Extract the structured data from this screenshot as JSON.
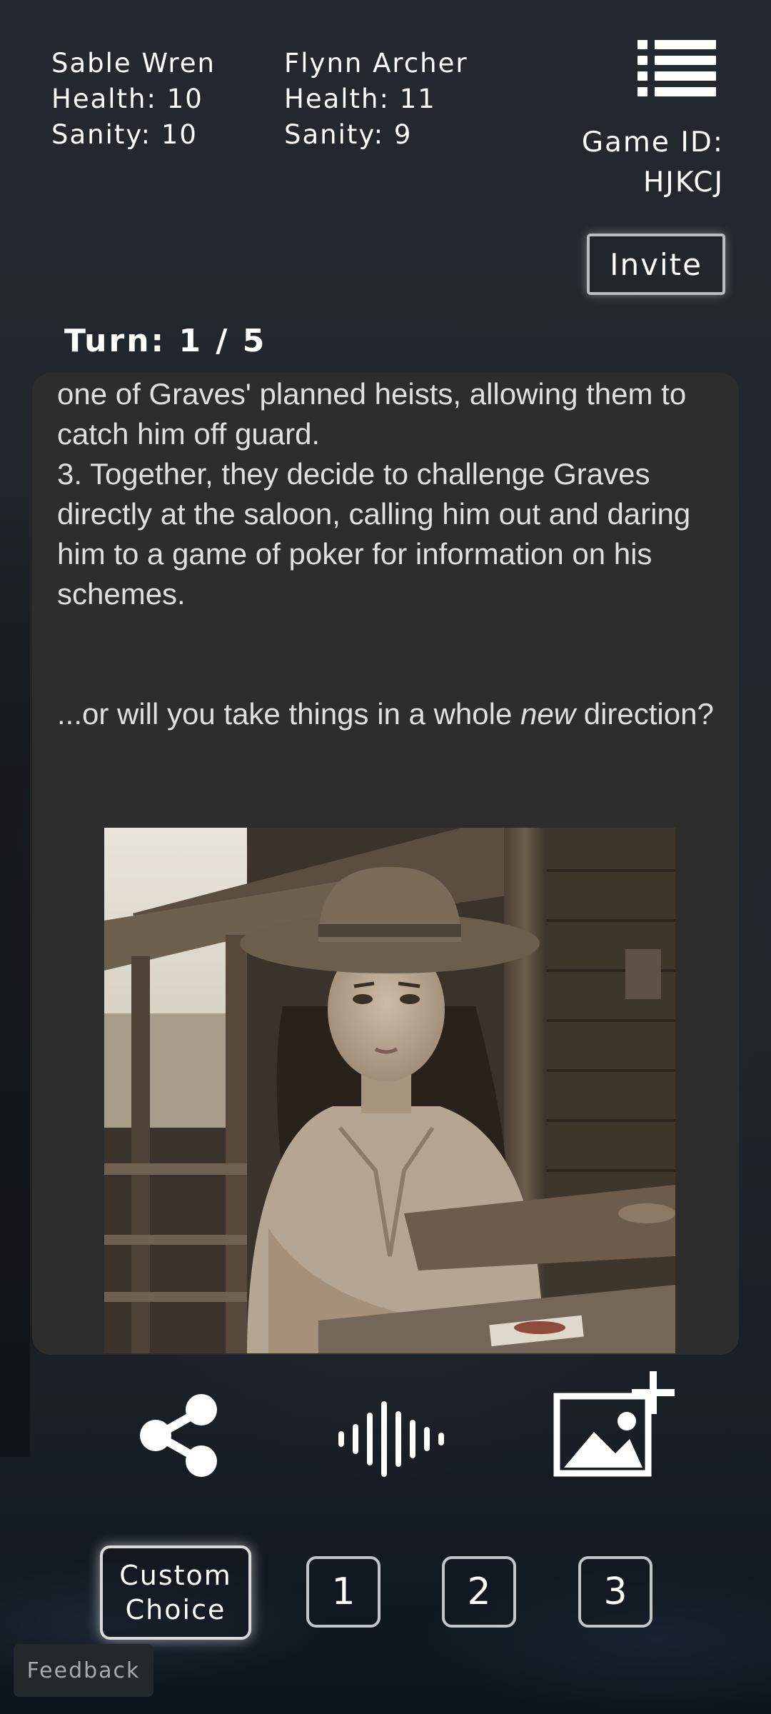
{
  "players": [
    {
      "name": "Sable Wren",
      "health": "Health: 10",
      "sanity": "Sanity: 10"
    },
    {
      "name": "Flynn Archer",
      "health": "Health: 11",
      "sanity": "Sanity: 9"
    }
  ],
  "header": {
    "menu_icon": "hamburger-list-icon",
    "game_id_label": "Game ID:",
    "game_id_value": "HJKCJ",
    "invite_label": "Invite"
  },
  "turn": {
    "label": "Turn: 1 / 5"
  },
  "story": {
    "line_1": "one of Graves' planned heists, allowing them to catch him off guard.",
    "line_2": "3. Together, they decide to challenge Graves directly at the saloon, calling him out and daring him to a game of poker for information on his schemes.",
    "prompt_before": "...or will you take things in a whole ",
    "prompt_emphasis": "new",
    "prompt_after": " direction?"
  },
  "actions": {
    "share_icon": "share-icon",
    "audio_icon": "audio-waveform-icon",
    "image_icon": "add-image-icon"
  },
  "choices": {
    "custom_line1": "Custom",
    "custom_line2": "Choice",
    "options": [
      "1",
      "2",
      "3"
    ]
  },
  "feedback": {
    "label": "Feedback"
  }
}
